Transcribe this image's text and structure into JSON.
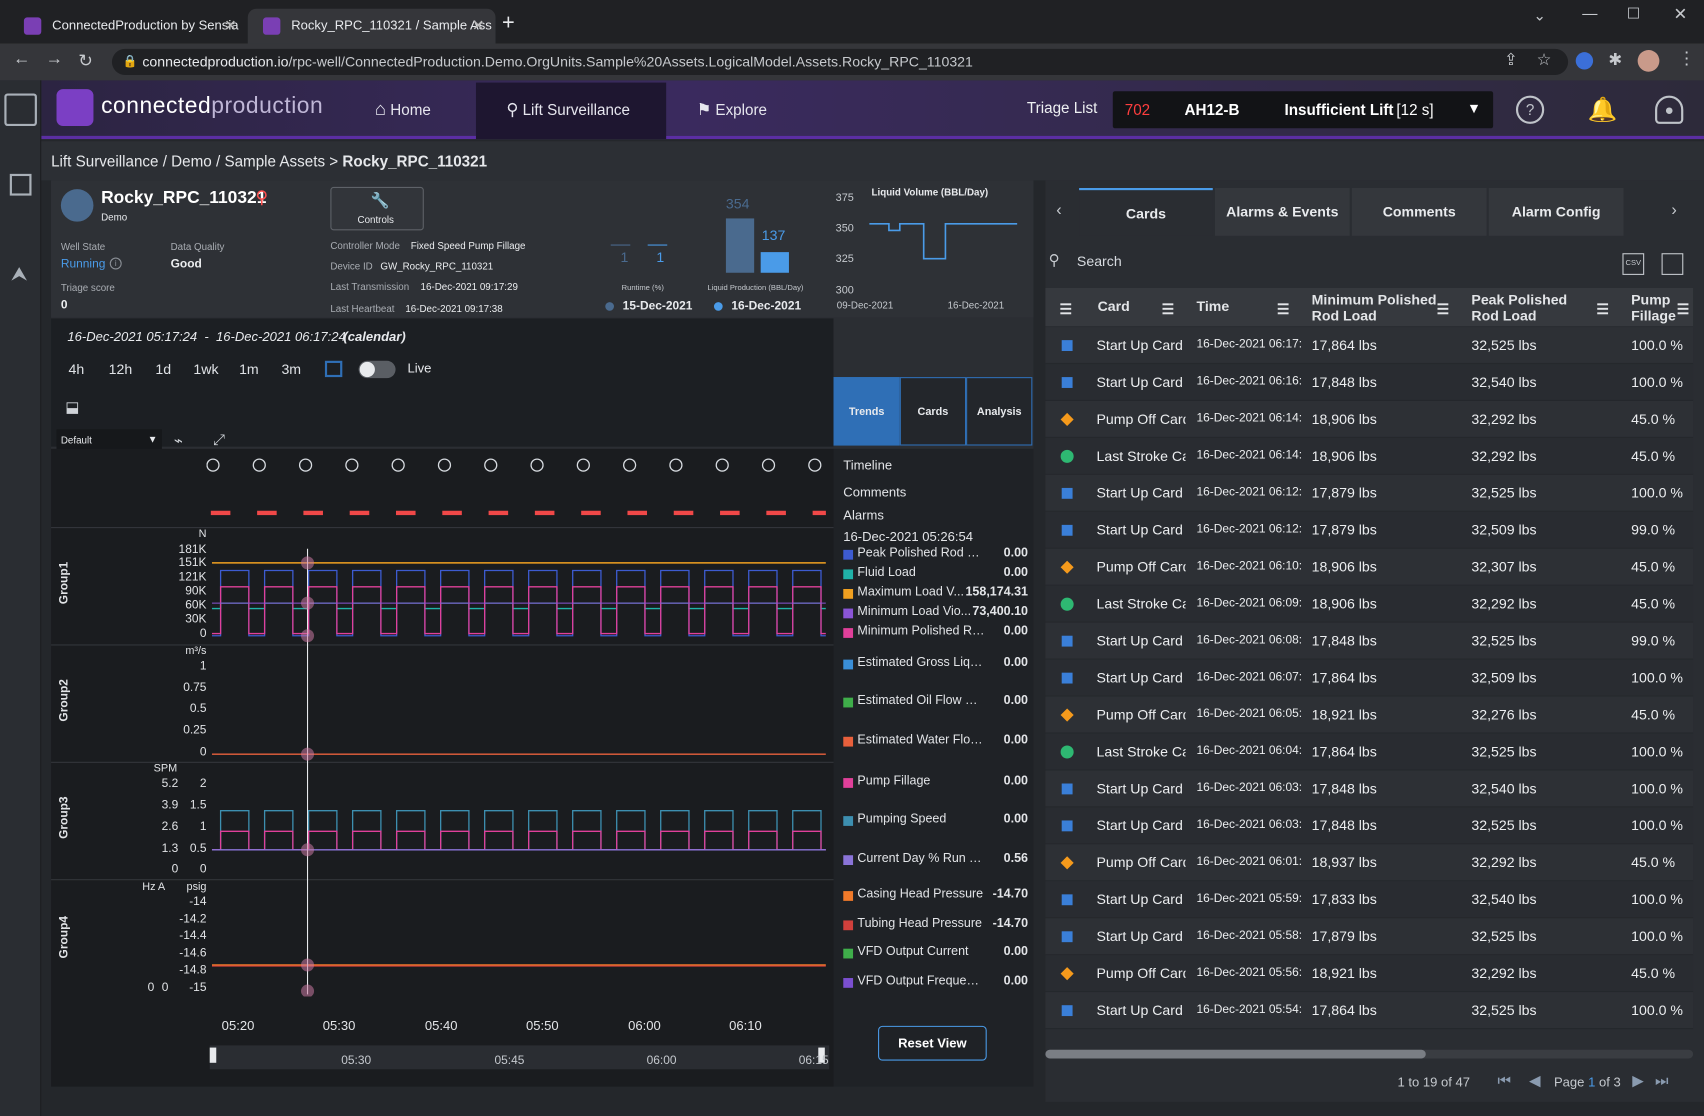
{
  "browser": {
    "tabs": [
      {
        "label": "ConnectedProduction by Sensia"
      },
      {
        "label": "Rocky_RPC_110321 / Sample Ass"
      }
    ],
    "new_tab": "+",
    "url_domain": "connectedproduction.io",
    "url_path": "/rpc-well/ConnectedProduction.Demo.OrgUnits.Sample%20Assets.LogicalModel.Assets.Rocky_RPC_110321"
  },
  "header": {
    "logo_text_a": "connected",
    "logo_text_b": "production",
    "nav": [
      {
        "label": "Home"
      },
      {
        "label": "Lift Surveillance"
      },
      {
        "label": "Explore"
      }
    ],
    "triage_label": "Triage List",
    "triage_count": "702",
    "triage_well": "AH12-B",
    "triage_reason": "Insufficient Lift",
    "triage_time": "[12 s]"
  },
  "breadcrumb": {
    "items": [
      "Lift Surveillance",
      "Demo",
      "Sample Assets"
    ],
    "seps": [
      "/",
      "/",
      ">"
    ],
    "current": "Rocky_RPC_110321"
  },
  "well": {
    "name": "Rocky_RPC_110321",
    "org": "Demo",
    "controls_label": "Controls",
    "well_state_label": "Well State",
    "well_state": "Running",
    "data_quality_label": "Data Quality",
    "data_quality": "Good",
    "triage_score_label": "Triage score",
    "triage_score": "0",
    "controller_mode_label": "Controller Mode",
    "controller_mode": "Fixed Speed Pump Fillage",
    "device_id_label": "Device ID",
    "device_id": "GW_Rocky_RPC_110321",
    "last_transmission_label": "Last Transmission",
    "last_transmission": "16-Dec-2021 09:17:29",
    "last_heartbeat_label": "Last Heartbeat",
    "last_heartbeat": "16-Dec-2021 09:17:38"
  },
  "mini_bars": {
    "runtime_label": "Runtime (%)",
    "liquid_label": "Liquid Production (BBL/Day)",
    "vals": [
      "1",
      "1",
      "354",
      "137"
    ],
    "runtime_values": [
      1,
      1
    ],
    "liquid_values": [
      354,
      137
    ],
    "date1": "15-Dec-2021",
    "date2": "16-Dec-2021"
  },
  "liquid_chart": {
    "title": "Liquid Volume (BBL/Day)",
    "yticks": [
      "375",
      "350",
      "325",
      "300"
    ],
    "xticks": [
      "09-Dec-2021",
      "16-Dec-2021"
    ]
  },
  "trend": {
    "range_text": "16-Dec-2021 05:17:24  -  16-Dec-2021 06:17:24",
    "range_mode": "(calendar)",
    "ranges": [
      "4h",
      "12h",
      "1d",
      "1wk",
      "1m",
      "3m"
    ],
    "live_label": "Live",
    "preset": "Default",
    "subtabs": [
      "Trends",
      "Cards",
      "Analysis"
    ],
    "timeline_labels": [
      "Timeline",
      "Comments",
      "Alarms"
    ],
    "cursor_time": "16-Dec-2021 05:26:54",
    "reset_label": "Reset View",
    "xticks": [
      "05:20",
      "05:30",
      "05:40",
      "05:50",
      "06:00",
      "06:10"
    ],
    "nav_ticks": [
      "05:30",
      "05:45",
      "06:00",
      "06:15"
    ],
    "groups": [
      {
        "name": "Group1",
        "unit": "N",
        "ticks": [
          "181K",
          "151K",
          "121K",
          "90K",
          "60K",
          "30K",
          "0"
        ]
      },
      {
        "name": "Group2",
        "unit": "m³/s",
        "ticks": [
          "1",
          "0.75",
          "0.5",
          "0.25",
          "0"
        ]
      },
      {
        "name": "Group3",
        "unit": "SPM",
        "ticks_left": [
          "5.2",
          "3.9",
          "2.6",
          "1.3",
          "0"
        ],
        "ticks_right": [
          "2",
          "1.5",
          "1",
          "0.5",
          "0"
        ]
      },
      {
        "name": "Group4",
        "unit": "Hz  A",
        "unit2": "psig",
        "ticks": [
          "-14",
          "-14.2",
          "-14.4",
          "-14.6",
          "-14.8",
          "-15"
        ],
        "ticks_left": [
          "0",
          "0"
        ]
      }
    ],
    "legend": [
      {
        "name": "Peak Polished Rod Load",
        "value": "0.00",
        "color": "#3d5bd0"
      },
      {
        "name": "Fluid Load",
        "value": "0.00",
        "color": "#20b2a8"
      },
      {
        "name": "Maximum Load V...",
        "value": "158,174.31",
        "color": "#f0a020"
      },
      {
        "name": "Minimum Load Vio...",
        "value": "73,400.10",
        "color": "#8a55d6"
      },
      {
        "name": "Minimum Polished Rod ...",
        "value": "0.00",
        "color": "#e0409a"
      },
      {
        "name": "Estimated Gross Liquid ...",
        "value": "0.00",
        "color": "#3a8fd8"
      },
      {
        "name": "Estimated Oil Flow Rate",
        "value": "0.00",
        "color": "#3fae4a"
      },
      {
        "name": "Estimated Water Flow R...",
        "value": "0.00",
        "color": "#e8603c"
      },
      {
        "name": "Pump Fillage",
        "value": "0.00",
        "color": "#e0409a"
      },
      {
        "name": "Pumping Speed",
        "value": "0.00",
        "color": "#3d8fb0"
      },
      {
        "name": "Current Day % Run Time",
        "value": "0.56",
        "color": "#8a74d8"
      },
      {
        "name": "Casing Head Pressure",
        "value": "-14.70",
        "color": "#f07a2a"
      },
      {
        "name": "Tubing Head Pressure",
        "value": "-14.70",
        "color": "#d0403c"
      },
      {
        "name": "VFD Output Current",
        "value": "0.00",
        "color": "#3fae4a"
      },
      {
        "name": "VFD Output Frequency",
        "value": "0.00",
        "color": "#7b4fd0"
      }
    ]
  },
  "cards_panel": {
    "tabs": [
      "Cards",
      "Alarms & Events",
      "Comments",
      "Alarm Config"
    ],
    "search_placeholder": "Search",
    "csv_label": "CSV",
    "columns": [
      "Card",
      "Time",
      "Minimum Polished Rod Load",
      "Peak Polished Rod Load",
      "Pump Fillage"
    ],
    "rows": [
      {
        "type": "square",
        "card": "Start Up Card",
        "time": "16-Dec-2021 06:17:",
        "min": "17,864 lbs",
        "peak": "32,525 lbs",
        "fill": "100.0 %"
      },
      {
        "type": "square",
        "card": "Start Up Card",
        "time": "16-Dec-2021 06:16:",
        "min": "17,848 lbs",
        "peak": "32,540 lbs",
        "fill": "100.0 %"
      },
      {
        "type": "diamond",
        "card": "Pump Off Card",
        "time": "16-Dec-2021 06:14:",
        "min": "18,906 lbs",
        "peak": "32,292 lbs",
        "fill": "45.0 %"
      },
      {
        "type": "circle",
        "card": "Last Stroke Card",
        "time": "16-Dec-2021 06:14:",
        "min": "18,906 lbs",
        "peak": "32,292 lbs",
        "fill": "45.0 %"
      },
      {
        "type": "square",
        "card": "Start Up Card",
        "time": "16-Dec-2021 06:12:",
        "min": "17,879 lbs",
        "peak": "32,525 lbs",
        "fill": "100.0 %"
      },
      {
        "type": "square",
        "card": "Start Up Card",
        "time": "16-Dec-2021 06:12:",
        "min": "17,879 lbs",
        "peak": "32,509 lbs",
        "fill": "99.0 %"
      },
      {
        "type": "diamond",
        "card": "Pump Off Card",
        "time": "16-Dec-2021 06:10:",
        "min": "18,906 lbs",
        "peak": "32,307 lbs",
        "fill": "45.0 %"
      },
      {
        "type": "circle",
        "card": "Last Stroke Card",
        "time": "16-Dec-2021 06:09:",
        "min": "18,906 lbs",
        "peak": "32,292 lbs",
        "fill": "45.0 %"
      },
      {
        "type": "square",
        "card": "Start Up Card",
        "time": "16-Dec-2021 06:08:",
        "min": "17,848 lbs",
        "peak": "32,525 lbs",
        "fill": "99.0 %"
      },
      {
        "type": "square",
        "card": "Start Up Card",
        "time": "16-Dec-2021 06:07:",
        "min": "17,864 lbs",
        "peak": "32,509 lbs",
        "fill": "100.0 %"
      },
      {
        "type": "diamond",
        "card": "Pump Off Card",
        "time": "16-Dec-2021 06:05:",
        "min": "18,921 lbs",
        "peak": "32,276 lbs",
        "fill": "45.0 %"
      },
      {
        "type": "circle",
        "card": "Last Stroke Card",
        "time": "16-Dec-2021 06:04:",
        "min": "17,864 lbs",
        "peak": "32,525 lbs",
        "fill": "100.0 %"
      },
      {
        "type": "square",
        "card": "Start Up Card",
        "time": "16-Dec-2021 06:03:",
        "min": "17,848 lbs",
        "peak": "32,540 lbs",
        "fill": "100.0 %"
      },
      {
        "type": "square",
        "card": "Start Up Card",
        "time": "16-Dec-2021 06:03:",
        "min": "17,848 lbs",
        "peak": "32,525 lbs",
        "fill": "100.0 %"
      },
      {
        "type": "diamond",
        "card": "Pump Off Card",
        "time": "16-Dec-2021 06:01:",
        "min": "18,937 lbs",
        "peak": "32,292 lbs",
        "fill": "45.0 %"
      },
      {
        "type": "square",
        "card": "Start Up Card",
        "time": "16-Dec-2021 05:59:",
        "min": "17,833 lbs",
        "peak": "32,540 lbs",
        "fill": "100.0 %"
      },
      {
        "type": "square",
        "card": "Start Up Card",
        "time": "16-Dec-2021 05:58:",
        "min": "17,879 lbs",
        "peak": "32,525 lbs",
        "fill": "100.0 %"
      },
      {
        "type": "diamond",
        "card": "Pump Off Card",
        "time": "16-Dec-2021 05:56:",
        "min": "18,921 lbs",
        "peak": "32,292 lbs",
        "fill": "45.0 %"
      },
      {
        "type": "square",
        "card": "Start Up Card",
        "time": "16-Dec-2021 05:54:",
        "min": "17,864 lbs",
        "peak": "32,525 lbs",
        "fill": "100.0 %"
      }
    ],
    "pager_summary": "1 to 19 of 47",
    "page_word": "Page",
    "page_num": "1",
    "page_of": "of 3"
  }
}
